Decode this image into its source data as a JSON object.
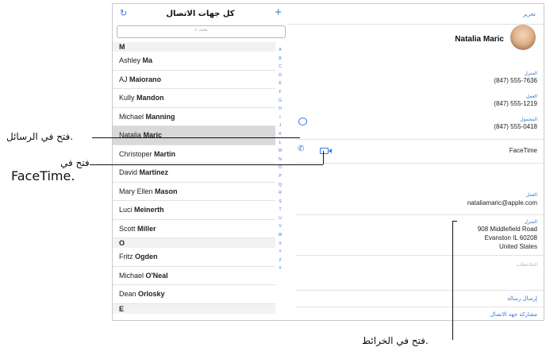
{
  "list": {
    "title": "كل جهات الاتصال",
    "add_icon": "+",
    "refresh_icon": "↻",
    "search_placeholder": "⌕ بحث",
    "sections": [
      {
        "header": "M",
        "rows": [
          {
            "first": "Ashley",
            "last": "Ma"
          },
          {
            "first": "AJ",
            "last": "Maiorano"
          },
          {
            "first": "Kully",
            "last": "Mandon"
          },
          {
            "first": "Michael",
            "last": "Manning"
          },
          {
            "first": "Natalia",
            "last": "Maric"
          },
          {
            "first": "Christoper",
            "last": "Martin"
          },
          {
            "first": "David",
            "last": "Martinez"
          },
          {
            "first": "Mary Ellen",
            "last": "Mason"
          },
          {
            "first": "Luci",
            "last": "Meinerth"
          },
          {
            "first": "Scott",
            "last": "Miller"
          }
        ]
      },
      {
        "header": "O",
        "rows": [
          {
            "first": "Fritz",
            "last": "Ogden"
          },
          {
            "first": "Michael",
            "last": "O'Neal"
          },
          {
            "first": "Dean",
            "last": "Orlosky"
          }
        ]
      },
      {
        "header": "E",
        "rows": []
      }
    ],
    "index_letters": [
      "A",
      "B",
      "C",
      "D",
      "E",
      "F",
      "G",
      "H",
      "I",
      "J",
      "K",
      "L",
      "M",
      "N",
      "O",
      "P",
      "Q",
      "R",
      "S",
      "T",
      "U",
      "V",
      "W",
      "X",
      "Y",
      "Z",
      "#"
    ]
  },
  "detail": {
    "edit_label": "تحرير",
    "name": "Natalia Maric",
    "home_label": "المنزل",
    "home_phone": "(847) 555-7636",
    "work_label": "العمل",
    "work_phone": "(847) 555-1219",
    "mobile_label": "المحمول",
    "mobile_phone": "(847) 555-0418",
    "facetime_label": "FaceTime",
    "email_label": "العمل",
    "email": "nataliamaric@apple.com",
    "address_label": "المنزل",
    "address_line1": "908 Middlefield Road",
    "address_line2": "Evanston IL 60208",
    "address_line3": "United States",
    "notes_label": "الملاحظات",
    "send_message": "إرسال رسالة",
    "share_contact": "مشاركة جهة الاتصال",
    "phone_icon": "✆"
  },
  "callouts": {
    "messages": "فتح في الرسائل.",
    "facetime_line1": "فتح في",
    "facetime_line2": "FaceTime.",
    "maps": "فتح في الخرائط."
  }
}
